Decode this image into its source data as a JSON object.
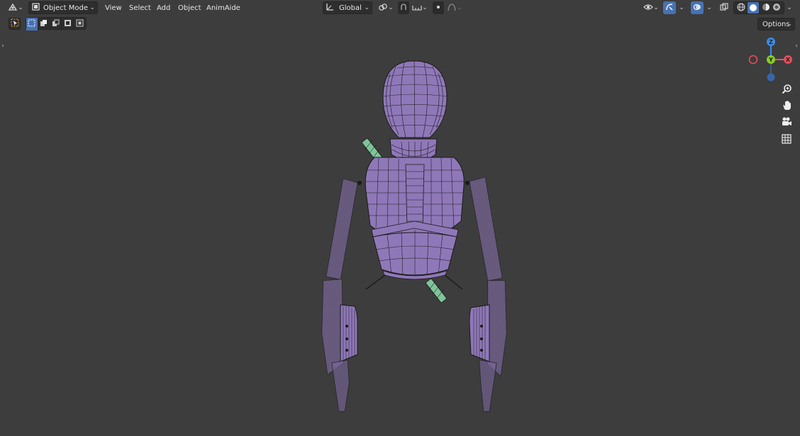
{
  "header": {
    "mode_label": "Object Mode",
    "menus": [
      "View",
      "Select",
      "Add",
      "Object",
      "AnimAide"
    ],
    "orientation_label": "Global",
    "options_label": "Options"
  },
  "gizmo": {
    "z": "Z",
    "y": "Y",
    "x": "X"
  },
  "icons": [
    "editor-type-icon",
    "object-mode-icon",
    "transform-orientation-icon",
    "snap-icon",
    "proportional-editing-icon",
    "visibility-icon",
    "gizmo-toggle-icon",
    "overlay-icon",
    "xray-icon",
    "wireframe-shading-icon",
    "solid-shading-icon",
    "material-preview-icon",
    "rendered-shading-icon",
    "zoom-icon",
    "pan-hand-icon",
    "camera-icon",
    "grid-icon"
  ],
  "colors": {
    "background": "#3d3d3d",
    "mesh": "#8f78b8",
    "wire": "#1a1a1a",
    "accent_blue": "#4772b3",
    "gizmo_x": "#e84c5b",
    "gizmo_y": "#88cc2a",
    "gizmo_z": "#3d8ce8",
    "green_parts": "#7fc49a"
  }
}
